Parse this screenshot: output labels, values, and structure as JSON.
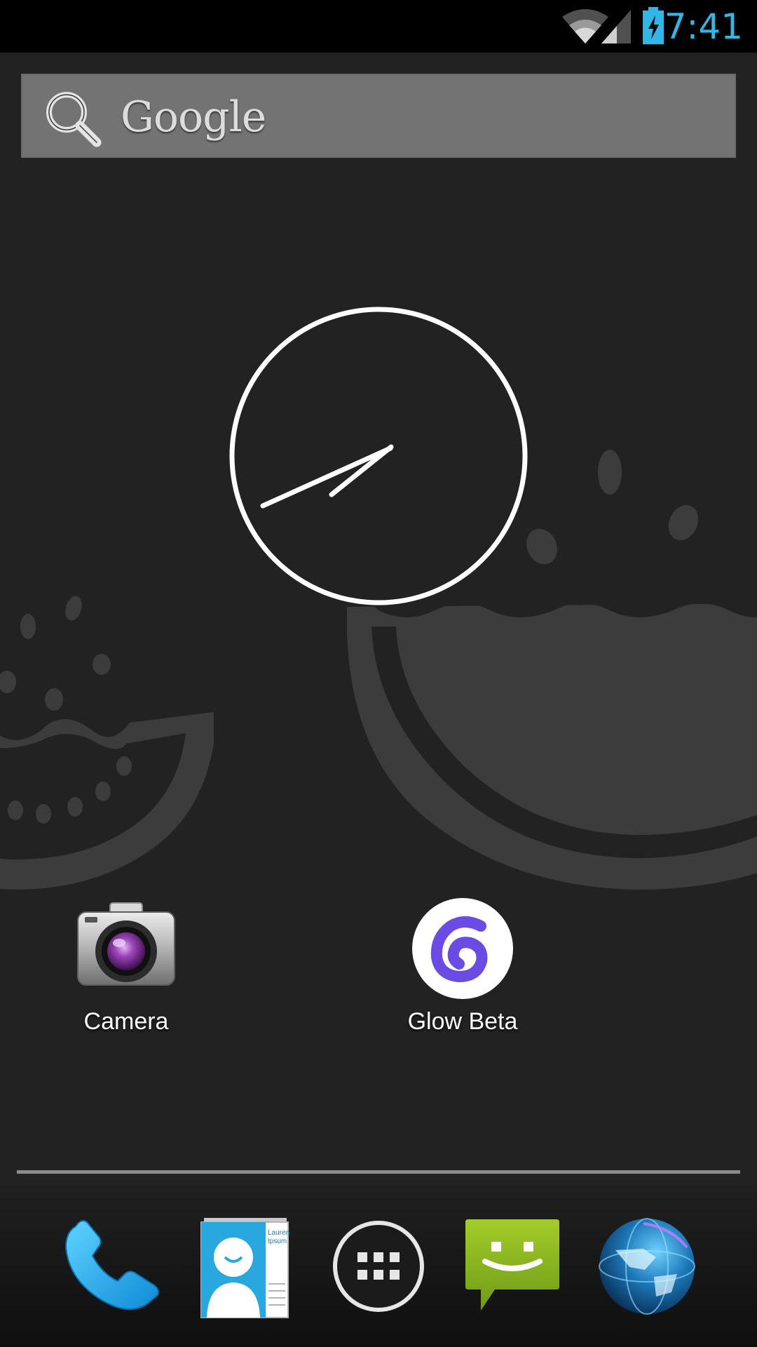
{
  "status_bar": {
    "time": "7:41",
    "icons": [
      "wifi-icon",
      "cell-signal-icon",
      "battery-charging-icon"
    ],
    "time_color": "#33b5e5"
  },
  "search_widget": {
    "brand": "Google",
    "icon": "search-icon"
  },
  "clock_widget": {
    "type": "analog-clock",
    "time": "7:41"
  },
  "desktop_apps": [
    {
      "label": "Camera",
      "icon": "camera-icon"
    },
    {
      "label": "Glow Beta",
      "icon": "glow-icon"
    }
  ],
  "dock": {
    "items": [
      {
        "name": "phone",
        "icon": "phone-icon"
      },
      {
        "name": "people",
        "icon": "contacts-icon",
        "card_text": [
          "Lauren",
          "Ipsum"
        ]
      },
      {
        "name": "apps",
        "icon": "app-drawer-icon"
      },
      {
        "name": "messaging",
        "icon": "messaging-icon"
      },
      {
        "name": "browser",
        "icon": "browser-globe-icon"
      }
    ]
  },
  "colors": {
    "background": "#222222",
    "wallpaper_shape": "#3c3c3c",
    "accent_blue": "#33b5e5",
    "messaging_green": "#8ab522",
    "glow_purple": "#6a4be3"
  }
}
